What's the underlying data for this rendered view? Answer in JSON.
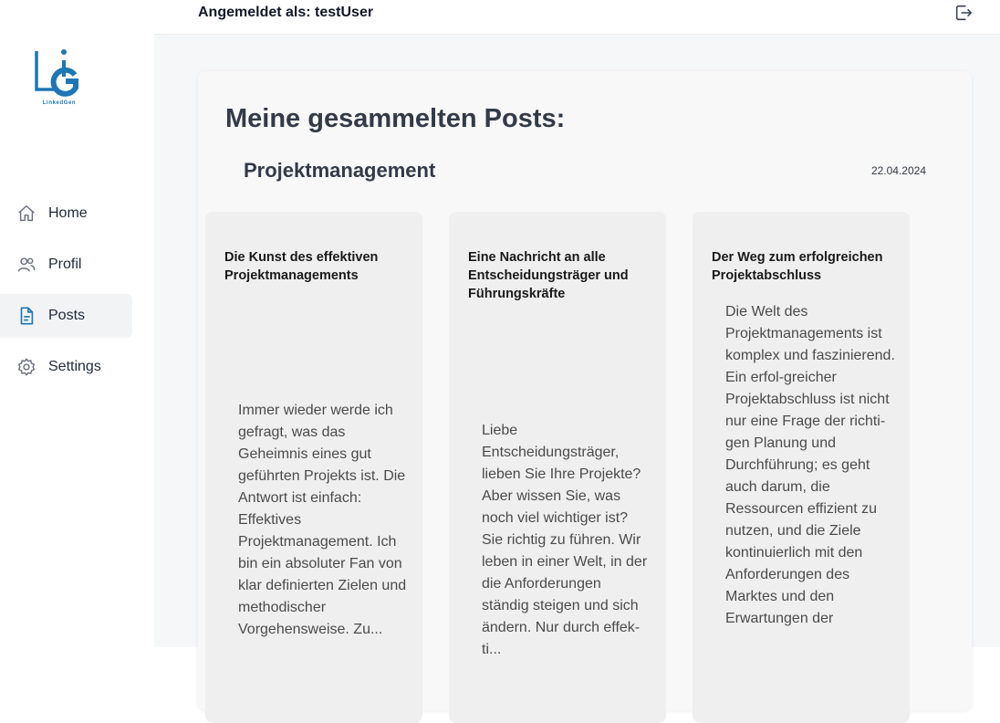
{
  "app": {
    "logo_text": "LinkedGen",
    "brand_color": "#1d76b5"
  },
  "sidebar": {
    "items": [
      {
        "label": "Home",
        "icon": "home-icon",
        "active": false
      },
      {
        "label": "Profil",
        "icon": "users-icon",
        "active": false
      },
      {
        "label": "Posts",
        "icon": "document-icon",
        "active": true
      },
      {
        "label": "Settings",
        "icon": "gear-icon",
        "active": false
      }
    ]
  },
  "header": {
    "user_label": "Angemeldet als: testUser",
    "logout_icon": "logout-icon"
  },
  "main": {
    "title": "Meine gesammelten Posts:",
    "section": {
      "title": "Projektmanagement",
      "date": "22.04.2024"
    },
    "cards": [
      {
        "title": "Die Kunst des effektiven Projektmanagements",
        "body": "Immer wieder werde ich gefragt, was das Geheimnis eines gut geführten Projekts ist. Die Antwort ist einfach: Effektives Projektmanagement. Ich bin ein absoluter Fan von klar definierten Zielen und methodischer Vorgehensweise. Zu..."
      },
      {
        "title": "Eine Nachricht an alle Entscheidungsträger und Führungskräfte",
        "body": "Liebe Entscheidungsträger, lieben Sie Ihre Projekte? Aber wissen Sie, was noch viel wichtiger ist? Sie richtig zu führen. Wir leben in einer Welt, in der die Anforderungen ständig steigen und sich ändern. Nur durch effek-ti..."
      },
      {
        "title": "Der Weg zum erfolgreichen Projektabschluss",
        "body": "Die Welt des Projektmanagements ist komplex und faszinierend. Ein erfol-greicher Projektabschluss ist nicht nur eine Frage der richti-gen Planung und Durchführung; es geht auch darum, die Ressourcen effizient zu nutzen, und die Ziele kontinuierlich mit den Anforderungen des Marktes und den Erwartungen der"
      }
    ]
  }
}
